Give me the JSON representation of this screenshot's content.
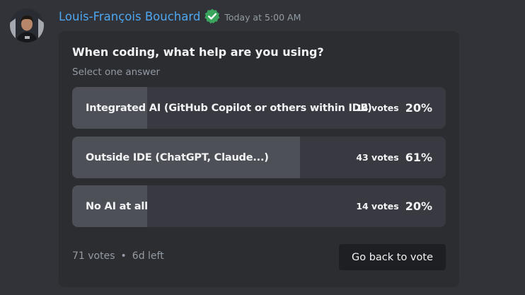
{
  "message": {
    "author": "Louis-François Bouchard",
    "timestamp": "Today at 5:00 AM"
  },
  "colors": {
    "author": "#4ea7ef",
    "verified_badge": "#3ba55d",
    "background": "#313338",
    "poll_background": "#2b2d31"
  },
  "poll": {
    "question": "When coding, what help are you using?",
    "subtitle": "Select one answer",
    "answers": [
      {
        "label": "Integrated AI (GitHub Copilot or others within IDE)",
        "votes": "14 votes",
        "percent": "20%",
        "fraction": 0.2
      },
      {
        "label": "Outside IDE (ChatGPT, Claude...)",
        "votes": "43 votes",
        "percent": "61%",
        "fraction": 0.61
      },
      {
        "label": "No AI at all",
        "votes": "14 votes",
        "percent": "20%",
        "fraction": 0.2
      }
    ],
    "total_votes": "71 votes",
    "separator": "•",
    "time_left": "6d left",
    "back_button": "Go back to vote"
  },
  "icons": {
    "verified": "verified-badge-icon"
  }
}
